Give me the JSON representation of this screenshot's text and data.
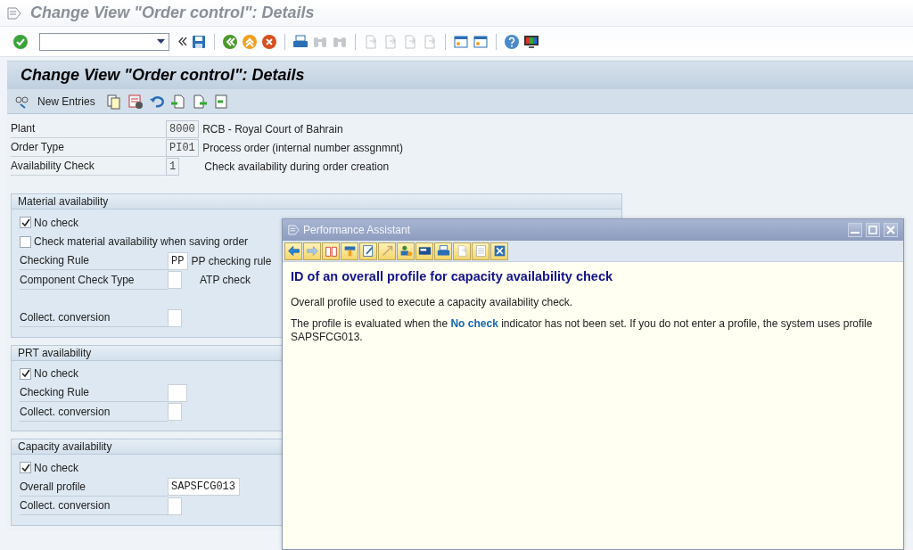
{
  "window": {
    "title": "Change View \"Order control\": Details"
  },
  "screen_title": "Change View \"Order control\": Details",
  "app_toolbar": {
    "new_entries": "New Entries"
  },
  "header_fields": [
    {
      "label": "Plant",
      "value": "8000",
      "description": "RCB - Royal Court of Bahrain"
    },
    {
      "label": "Order Type",
      "value": "PI01",
      "description": "Process order (internal number assgnmnt)"
    },
    {
      "label": "Availability Check",
      "value": "1",
      "description": "Check availability during order creation"
    }
  ],
  "groups": [
    {
      "title": "Material availability",
      "items": [
        {
          "kind": "checkbox",
          "label": "No check",
          "checked": true
        },
        {
          "kind": "checkbox",
          "label": "Check material availability when saving order",
          "checked": false
        },
        {
          "kind": "field",
          "label": "Checking Rule",
          "value": "PP",
          "description": "PP checking rule"
        },
        {
          "kind": "field",
          "label": "Component Check Type",
          "description": "ATP check"
        },
        {
          "kind": "gap"
        },
        {
          "kind": "field",
          "label": "Collect. conversion"
        }
      ]
    },
    {
      "title": "PRT availability",
      "items": [
        {
          "kind": "checkbox",
          "label": "No check",
          "checked": true
        },
        {
          "kind": "field",
          "label": "Checking Rule"
        },
        {
          "kind": "field",
          "label": "Collect. conversion"
        }
      ]
    },
    {
      "title": "Capacity availability",
      "items": [
        {
          "kind": "checkbox",
          "label": "No check",
          "checked": true
        },
        {
          "kind": "field",
          "label": "Overall profile",
          "value": "SAPSFCG013"
        },
        {
          "kind": "field",
          "label": "Collect. conversion"
        }
      ]
    }
  ],
  "performance_assistant": {
    "title": "Performance Assistant",
    "heading": "ID of an overall profile for capacity availability check",
    "paragraphs": [
      "Overall profile used to execute a capacity availability check.",
      "The profile is evaluated when the **No check** indicator has not been set. If you do not enter a profile, the system uses profile SAPSFCG013."
    ]
  }
}
